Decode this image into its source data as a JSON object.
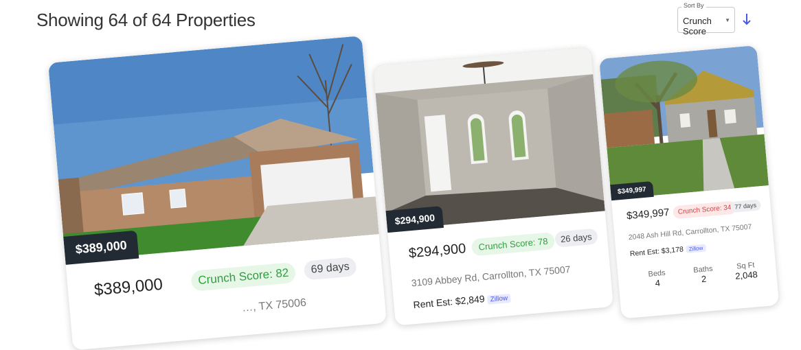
{
  "header": {
    "title": "Showing 64 of 64 Properties"
  },
  "sort": {
    "label": "Sort By",
    "value": "Crunch Score"
  },
  "colors": {
    "accent": "#4a57e0",
    "score_good": "#2f9e3e",
    "score_bad": "#d94040",
    "price_tag": "#222b33"
  },
  "listings": [
    {
      "price_tag": "$389,000",
      "price": "$389,000",
      "score": "Crunch Score: 82",
      "days": "69 days",
      "address": "…, TX 75006"
    },
    {
      "price_tag": "$294,900",
      "price": "$294,900",
      "score": "Crunch Score: 78",
      "days": "26 days",
      "address": "3109 Abbey Rd, Carrollton, TX 75007",
      "rent": "Rent Est: $2,849",
      "rent_source": "Zillow"
    },
    {
      "price_tag": "$349,997",
      "price": "$349,997",
      "score": "Crunch Score: 34",
      "days": "77 days",
      "address": "2048 Ash Hill Rd, Carrollton, TX 75007",
      "rent": "Rent Est: $3,178",
      "rent_source": "Zillow",
      "stats": [
        {
          "label": "Beds",
          "value": "4"
        },
        {
          "label": "Baths",
          "value": "2"
        },
        {
          "label": "Sq Ft",
          "value": "2,048"
        }
      ]
    }
  ]
}
